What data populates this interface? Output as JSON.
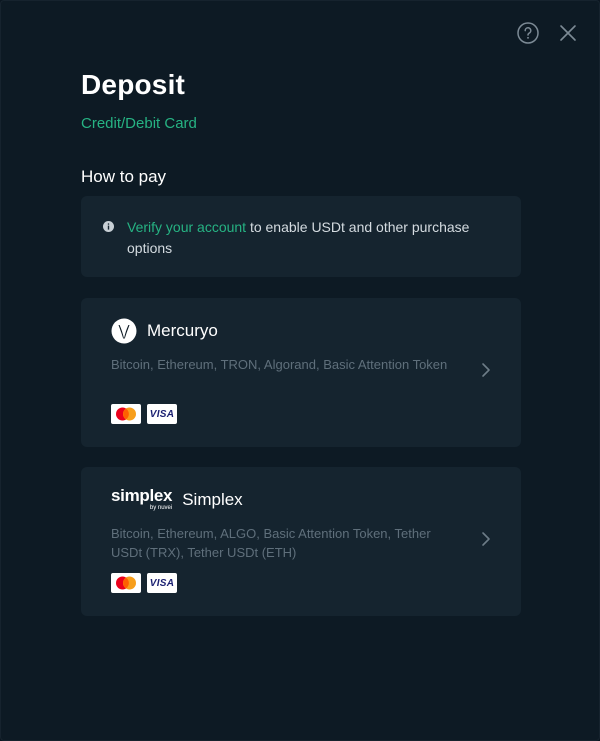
{
  "header": {
    "help_icon": "help-circle-icon",
    "close_icon": "close-icon"
  },
  "title": "Deposit",
  "subtitle": "Credit/Debit Card",
  "section_heading": "How to pay",
  "info": {
    "icon": "info-icon",
    "link_text": "Verify your account",
    "text": " to enable USDt and other purchase options"
  },
  "providers": [
    {
      "name": "Mercuryo",
      "logo": "mercuryo-logo",
      "coins": "Bitcoin, Ethereum, TRON, Algorand, Basic Attention Token",
      "payment_methods": [
        "mastercard",
        "VISA"
      ]
    },
    {
      "name": "Simplex",
      "logo": "simplex-logo",
      "logo_text": "simplex",
      "logo_sub": "by nuvei",
      "coins": "Bitcoin, Ethereum, ALGO, Basic Attention Token, Tether USDt (TRX), Tether USDt (ETH)",
      "payment_methods": [
        "mastercard",
        "VISA"
      ]
    }
  ],
  "colors": {
    "background": "#0d1a24",
    "card": "#15242f",
    "accent": "#26b383",
    "muted_text": "#5f6f7b"
  }
}
